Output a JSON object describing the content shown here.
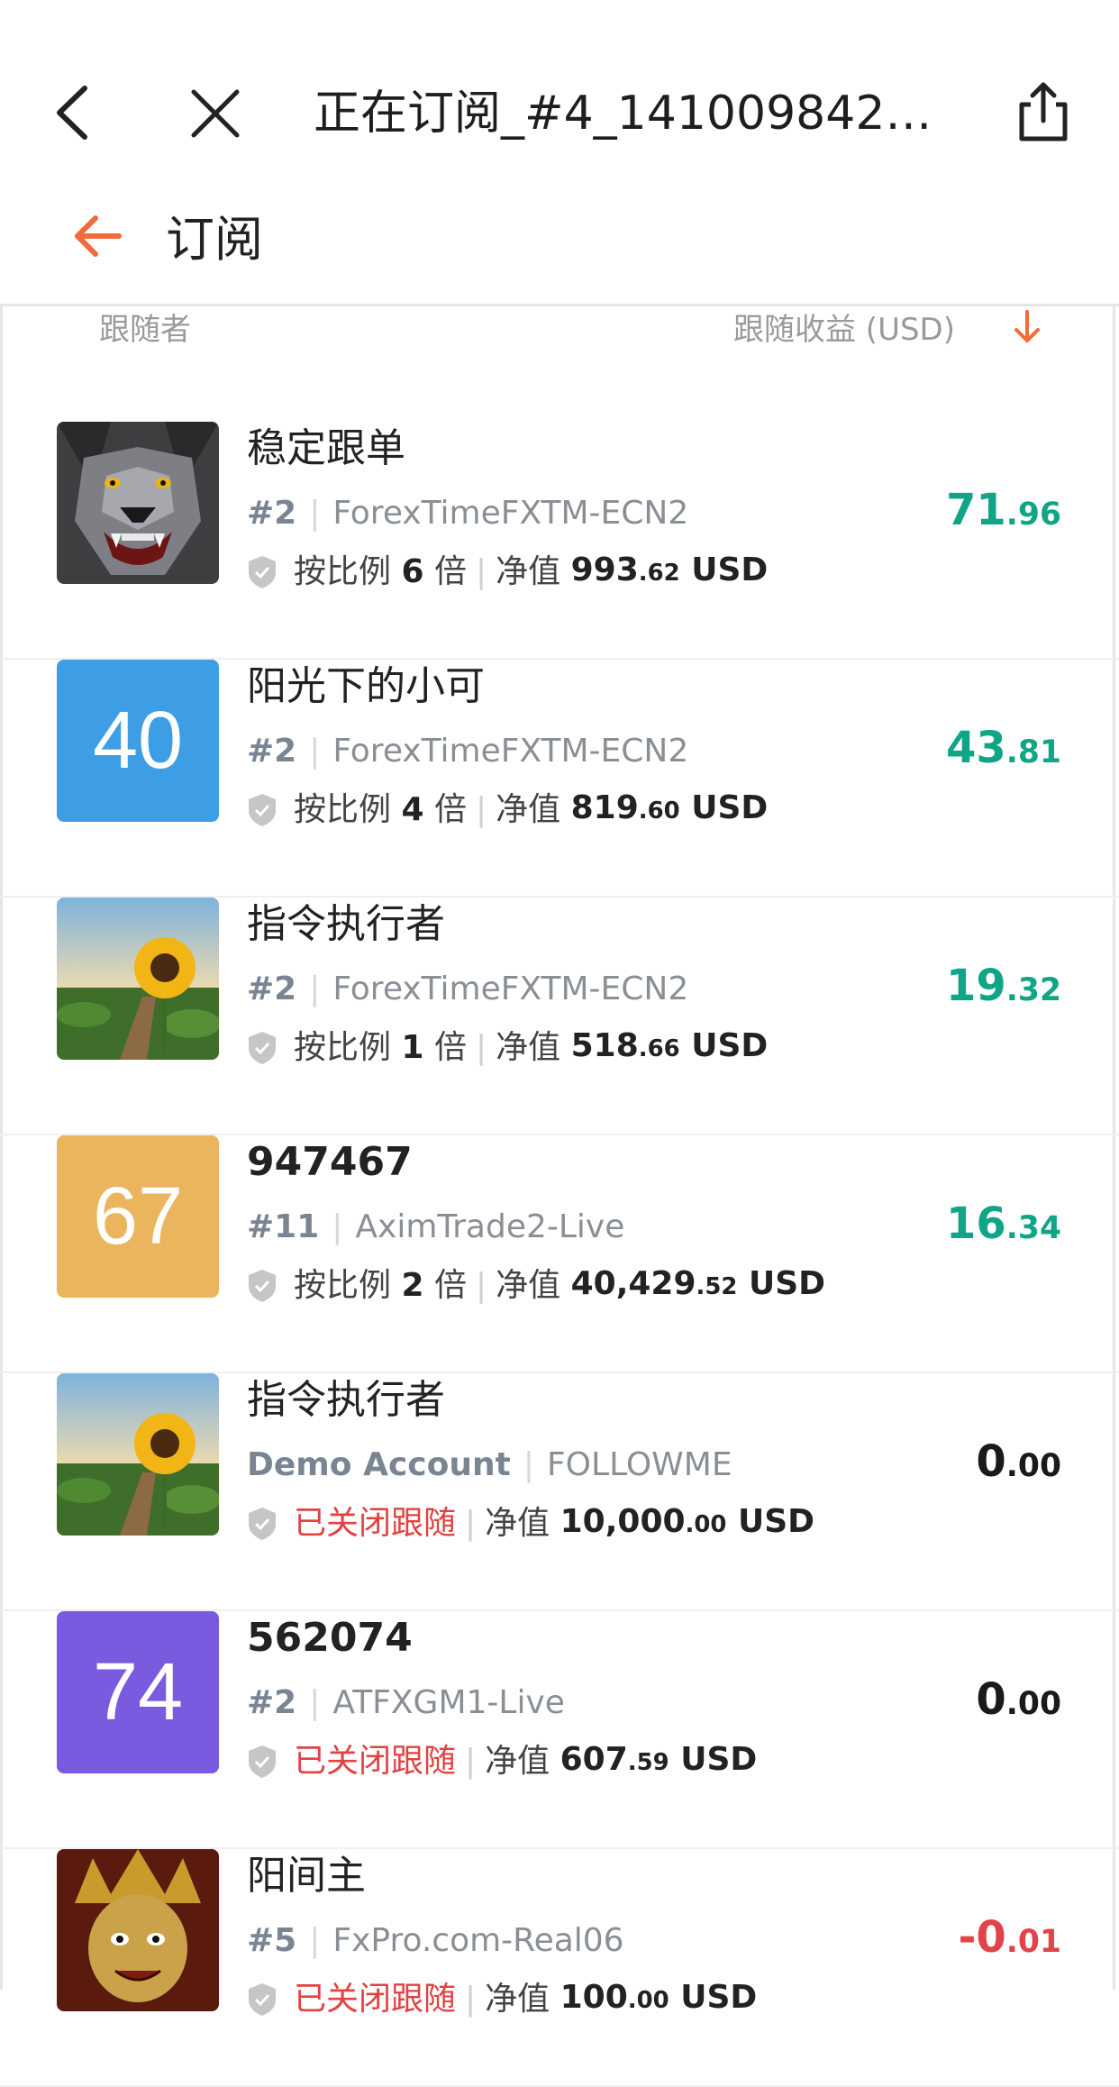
{
  "nav": {
    "title": "正在订阅_#4_141009842 -..."
  },
  "subheader": {
    "title": "订阅"
  },
  "columns": {
    "follower": "跟随者",
    "profit": "跟随收益 (USD)"
  },
  "colors": {
    "accent": "#f26b3a",
    "positive": "#11a587",
    "negative": "#e2424a",
    "closed": "#e24242"
  },
  "rows": [
    {
      "name": "稳定跟单",
      "avatar": "wolf",
      "account": "#2",
      "server": "ForexTimeFXTM-ECN2",
      "ratio_label": "按比例",
      "ratio": "6",
      "ratio_unit": "倍",
      "equity_label": "净值",
      "equity_int": "993",
      "equity_dec": ".62",
      "equity_unit": "USD",
      "profit_int": "71",
      "profit_dec": ".96",
      "profit_color": "#11a587"
    },
    {
      "name": "阳光下的小可",
      "avatar_text": "40",
      "avatar_bg": "#3d9ee6",
      "account": "#2",
      "server": "ForexTimeFXTM-ECN2",
      "ratio_label": "按比例",
      "ratio": "4",
      "ratio_unit": "倍",
      "equity_label": "净值",
      "equity_int": "819",
      "equity_dec": ".60",
      "equity_unit": "USD",
      "profit_int": "43",
      "profit_dec": ".81",
      "profit_color": "#11a587"
    },
    {
      "name": "指令执行者",
      "avatar": "sunflower",
      "account": "#2",
      "server": "ForexTimeFXTM-ECN2",
      "ratio_label": "按比例",
      "ratio": "1",
      "ratio_unit": "倍",
      "equity_label": "净值",
      "equity_int": "518",
      "equity_dec": ".66",
      "equity_unit": "USD",
      "profit_int": "19",
      "profit_dec": ".32",
      "profit_color": "#11a587"
    },
    {
      "name": "947467",
      "avatar_text": "67",
      "avatar_bg": "#eab55c",
      "account": "#11",
      "server": "AximTrade2-Live",
      "ratio_label": "按比例",
      "ratio": "2",
      "ratio_unit": "倍",
      "equity_label": "净值",
      "equity_int": "40,429",
      "equity_dec": ".52",
      "equity_unit": "USD",
      "profit_int": "16",
      "profit_dec": ".34",
      "profit_color": "#11a587"
    },
    {
      "name": "指令执行者",
      "avatar": "sunflower",
      "account": "Demo Account",
      "server": "FOLLOWME",
      "status": "已关闭跟随",
      "equity_label": "净值",
      "equity_int": "10,000",
      "equity_dec": ".00",
      "equity_unit": "USD",
      "profit_int": "0",
      "profit_dec": ".00",
      "profit_color": "#1a1a1a"
    },
    {
      "name": "562074",
      "avatar_text": "74",
      "avatar_bg": "#7a5be0",
      "account": "#2",
      "server": "ATFXGM1-Live",
      "status": "已关闭跟随",
      "equity_label": "净值",
      "equity_int": "607",
      "equity_dec": ".59",
      "equity_unit": "USD",
      "profit_int": "0",
      "profit_dec": ".00",
      "profit_color": "#1a1a1a"
    },
    {
      "name": "阳间主",
      "avatar": "deity",
      "account": "#5",
      "server": "FxPro.com-Real06",
      "status": "已关闭跟随",
      "equity_label": "净值",
      "equity_int": "100",
      "equity_dec": ".00",
      "equity_unit": "USD",
      "profit_int": "-0",
      "profit_dec": ".01",
      "profit_color": "#e2424a"
    }
  ]
}
